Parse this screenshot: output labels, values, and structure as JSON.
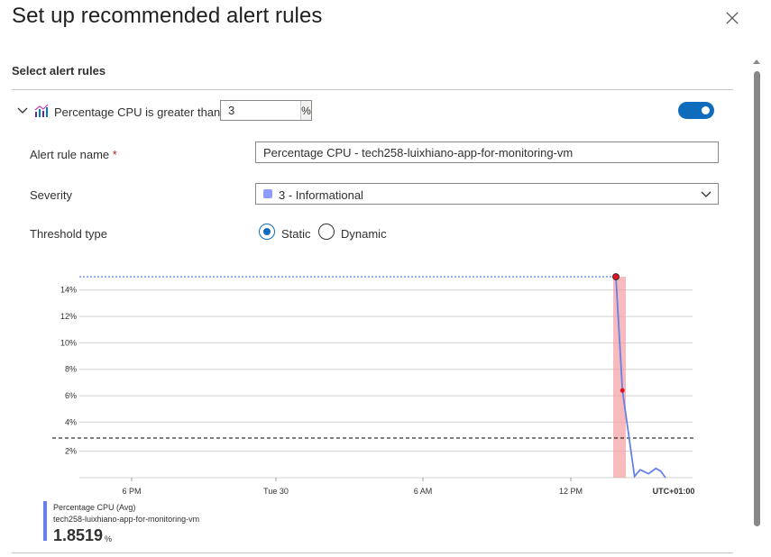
{
  "panel": {
    "title": "Set up recommended alert rules",
    "close_label": "Close"
  },
  "section": {
    "title": "Select alert rules"
  },
  "rule": {
    "label": "Percentage CPU is greater than",
    "threshold_value": "3",
    "threshold_unit": "%",
    "enabled": true
  },
  "fields": {
    "alert_rule_name_label": "Alert rule name",
    "required_marker": "*",
    "alert_rule_name_value": "Percentage CPU - tech258-luixhiano-app-for-monitoring-vm",
    "severity_label": "Severity",
    "severity_value": "3 - Informational",
    "severity_color": "#8e9bff",
    "threshold_type_label": "Threshold type",
    "threshold_options": [
      "Static",
      "Dynamic"
    ],
    "threshold_selected": "Static"
  },
  "chart_data": {
    "type": "line",
    "y_tick_labels": [
      "14%",
      "12%",
      "10%",
      "8%",
      "6%",
      "4%",
      "2%"
    ],
    "y_ticks": [
      14,
      12,
      10,
      8,
      6,
      4,
      2
    ],
    "ylim": [
      0,
      15
    ],
    "x_tick_labels": [
      "6 PM",
      "Tue 30",
      "6 AM",
      "12 PM"
    ],
    "timezone_label": "UTC+01:00",
    "threshold": 3,
    "max_marker": 15.2,
    "series": [
      {
        "name": "Percentage CPU (Avg)",
        "resource": "tech258-luixhiano-app-for-monitoring-vm",
        "color": "#6580e8",
        "points": [
          {
            "x": 14.1,
            "y": 15.2
          },
          {
            "x": 14.37,
            "y": 6.6
          },
          {
            "x": 14.87,
            "y": 0.1
          },
          {
            "x": 15.1,
            "y": 0.6
          },
          {
            "x": 15.45,
            "y": 0.3
          },
          {
            "x": 15.75,
            "y": 0.7
          },
          {
            "x": 15.95,
            "y": 0.5
          },
          {
            "x": 16.15,
            "y": 0.0
          }
        ]
      }
    ]
  },
  "legend": {
    "metric": "Percentage CPU (Avg)",
    "resource": "tech258-luixhiano-app-for-monitoring-vm",
    "value": "1.8519",
    "unit": "%"
  }
}
